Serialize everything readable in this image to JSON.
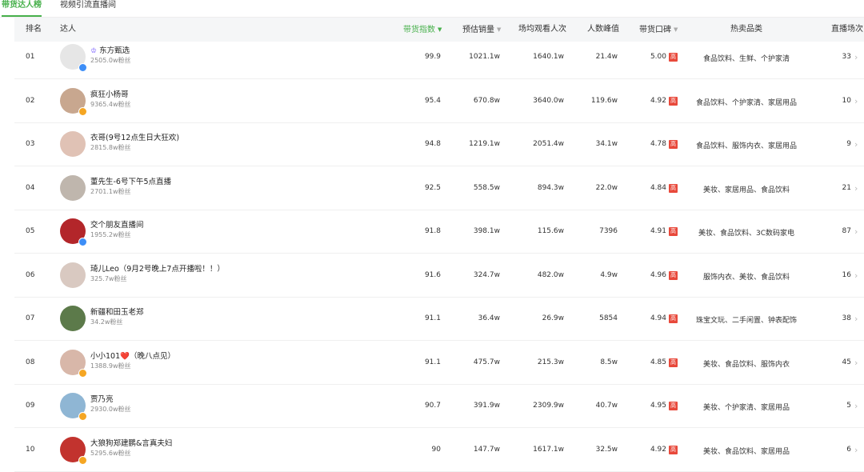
{
  "tabs": [
    {
      "label": "带货达人榜",
      "active": true
    },
    {
      "label": "视频引流直播间",
      "active": false
    }
  ],
  "columns": {
    "rank": "排名",
    "streamer": "达人",
    "index": "带货指数",
    "sales": "预估销量",
    "views": "场均观看人次",
    "peak": "人数峰值",
    "score": "带货口碑",
    "categories": "热卖品类",
    "lives": "直播场次"
  },
  "sort_indicators": {
    "index": "▼",
    "sales": "▼",
    "score": "▼"
  },
  "high_label": "高",
  "chevron": "›",
  "badge_colors": {
    "blue": "#3d8ef7",
    "gold": "#f5a623"
  },
  "accent": "#47b04b",
  "rows": [
    {
      "rank": "01",
      "name": "东方甄选",
      "crown": "♔",
      "fans": "2505.0w粉丝",
      "index": "99.9",
      "sales": "1021.1w",
      "views": "1640.1w",
      "peak": "21.4w",
      "score": "5.00",
      "categories": "食品饮料、生鲜、个护家清",
      "lives": "33",
      "avatar_color": "#e6e6e6",
      "badge": "blue"
    },
    {
      "rank": "02",
      "name": "疯狂小杨哥",
      "fans": "9365.4w粉丝",
      "index": "95.4",
      "sales": "670.8w",
      "views": "3640.0w",
      "peak": "119.6w",
      "score": "4.92",
      "categories": "食品饮料、个护家清、家居用品",
      "lives": "10",
      "avatar_color": "#c8a78f",
      "badge": "gold"
    },
    {
      "rank": "03",
      "name": "衣哥(9号12点生日大狂欢)",
      "fans": "2815.8w粉丝",
      "index": "94.8",
      "sales": "1219.1w",
      "views": "2051.4w",
      "peak": "34.1w",
      "score": "4.78",
      "categories": "食品饮料、服饰内衣、家居用品",
      "lives": "9",
      "avatar_color": "#e0c2b5",
      "badge": ""
    },
    {
      "rank": "04",
      "name": "董先生-6号下午5点直播",
      "fans": "2701.1w粉丝",
      "index": "92.5",
      "sales": "558.5w",
      "views": "894.3w",
      "peak": "22.0w",
      "score": "4.84",
      "categories": "美妆、家居用品、食品饮料",
      "lives": "21",
      "avatar_color": "#bfb6ad",
      "badge": ""
    },
    {
      "rank": "05",
      "name": "交个朋友直播间",
      "fans": "1955.2w粉丝",
      "index": "91.8",
      "sales": "398.1w",
      "views": "115.6w",
      "peak": "7396",
      "score": "4.91",
      "categories": "美妆、食品饮料、3C数码家电",
      "lives": "87",
      "avatar_color": "#b3262a",
      "badge": "blue"
    },
    {
      "rank": "06",
      "name": "琦儿Leo（9月2号晚上7点开播啦！！）",
      "fans": "325.7w粉丝",
      "index": "91.6",
      "sales": "324.7w",
      "views": "482.0w",
      "peak": "4.9w",
      "score": "4.96",
      "categories": "服饰内衣、美妆、食品饮料",
      "lives": "16",
      "avatar_color": "#d9c9c1",
      "badge": ""
    },
    {
      "rank": "07",
      "name": "新疆和田玉老郑",
      "fans": "34.2w粉丝",
      "index": "91.1",
      "sales": "36.4w",
      "views": "26.9w",
      "peak": "5854",
      "score": "4.94",
      "categories": "珠宝文玩、二手闲置、钟表配饰",
      "lives": "38",
      "avatar_color": "#5c7a4a",
      "badge": ""
    },
    {
      "rank": "08",
      "name": "小小101❤️（晚八点见）",
      "fans": "1388.9w粉丝",
      "index": "91.1",
      "sales": "475.7w",
      "views": "215.3w",
      "peak": "8.5w",
      "score": "4.85",
      "categories": "美妆、食品饮料、服饰内衣",
      "lives": "45",
      "avatar_color": "#d8b7a9",
      "badge": "gold"
    },
    {
      "rank": "09",
      "name": "贾乃亮",
      "fans": "2930.0w粉丝",
      "index": "90.7",
      "sales": "391.9w",
      "views": "2309.9w",
      "peak": "40.7w",
      "score": "4.95",
      "categories": "美妆、个护家清、家居用品",
      "lives": "5",
      "avatar_color": "#8fb6d4",
      "badge": "gold"
    },
    {
      "rank": "10",
      "name": "大狼狗郑建鹏&言真夫妇",
      "fans": "5295.6w粉丝",
      "index": "90",
      "sales": "147.7w",
      "views": "1617.1w",
      "peak": "32.5w",
      "score": "4.92",
      "categories": "美妆、食品饮料、家居用品",
      "lives": "6",
      "avatar_color": "#c2332e",
      "badge": "gold"
    }
  ]
}
